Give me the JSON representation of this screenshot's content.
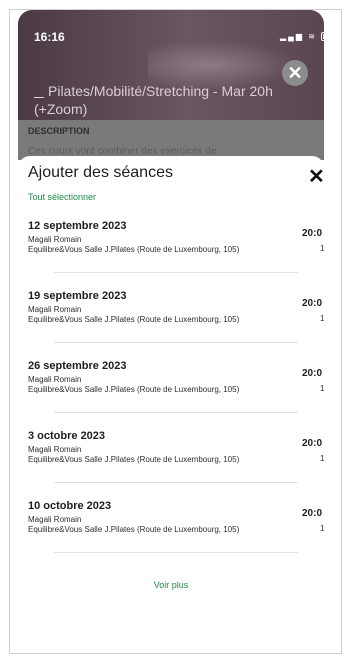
{
  "status": {
    "time": "16:16"
  },
  "background": {
    "class_title": "Pilates/Mobilité/Stretching - Mar 20h (+Zoom)",
    "description_label": "DESCRIPTION",
    "description_text": "Ces cours vont combiner des exercices de"
  },
  "sheet": {
    "title": "Ajouter des séances",
    "select_all": "Tout sélectionner",
    "see_more": "Voir plus",
    "sessions": [
      {
        "date": "12 septembre 2023",
        "coach": "Magali Romain",
        "place": "Equilibre&Vous Salle J.Pilates (Route de Luxembourg, 105)",
        "time": "20:0",
        "count": "1"
      },
      {
        "date": "19 septembre 2023",
        "coach": "Magali Romain",
        "place": "Equilibre&Vous Salle J.Pilates (Route de Luxembourg, 105)",
        "time": "20:0",
        "count": "1"
      },
      {
        "date": "26 septembre 2023",
        "coach": "Magali Romain",
        "place": "Equilibre&Vous Salle J.Pilates (Route de Luxembourg, 105)",
        "time": "20:0",
        "count": "1"
      },
      {
        "date": "3 octobre 2023",
        "coach": "Magali Romain",
        "place": "Equilibre&Vous Salle J.Pilates (Route de Luxembourg, 105)",
        "time": "20:0",
        "count": "1"
      },
      {
        "date": "10 octobre 2023",
        "coach": "Magali Romain",
        "place": "Equilibre&Vous Salle J.Pilates (Route de Luxembourg, 105)",
        "time": "20:0",
        "count": "1"
      }
    ]
  },
  "colors": {
    "accent": "#1f8a4c",
    "overlay": "#7a7a7a"
  },
  "icons": {
    "close_sheet": "close-icon",
    "close_background": "close-circle-icon",
    "location": "location-pin-icon"
  }
}
